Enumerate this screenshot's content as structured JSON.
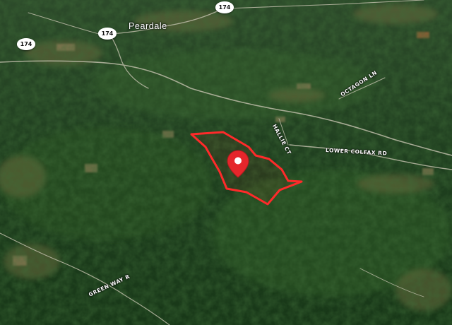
{
  "map": {
    "type": "satellite",
    "place_label": "Peardale",
    "highway_shields": [
      "174",
      "174",
      "174"
    ],
    "road_labels": {
      "octagon": "OCTAGON LN",
      "lower_colfax": "LOWER COLFAX RD",
      "hallie": "HALLIE CT",
      "green_way": "GREEN WAY R"
    },
    "boundary_color": "#ff2a2a",
    "marker_color": "#e5262b"
  }
}
